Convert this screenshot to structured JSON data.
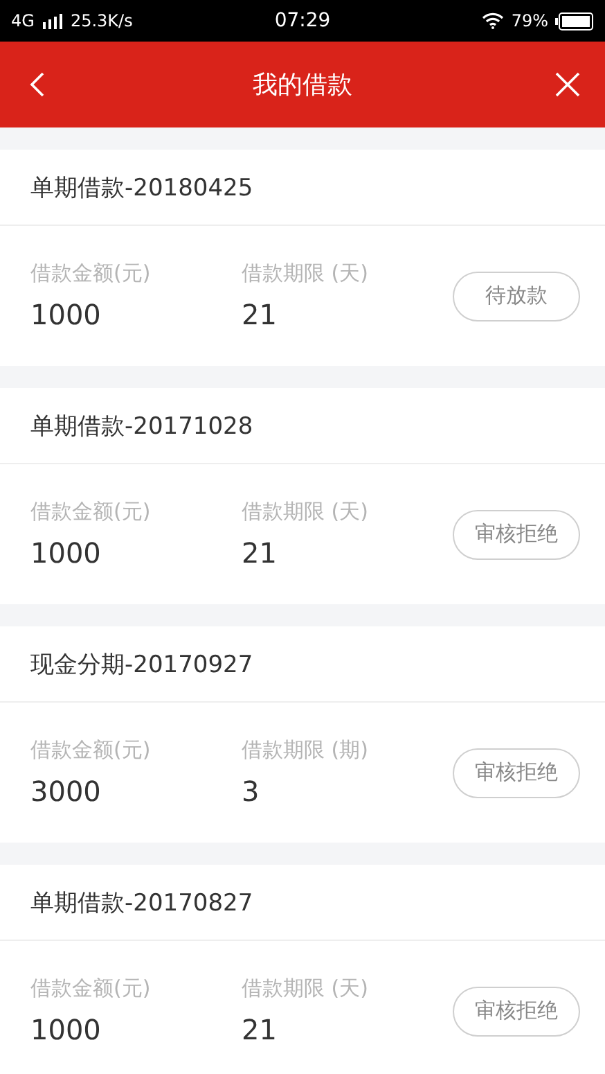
{
  "status_bar": {
    "network": "4G",
    "speed": "25.3K/s",
    "time": "07:29",
    "battery": "79%"
  },
  "header": {
    "title": "我的借款"
  },
  "loans": [
    {
      "title": "单期借款-20180425",
      "amount_label": "借款金额(元)",
      "amount": "1000",
      "term_label": "借款期限 (天)",
      "term": "21",
      "status": "待放款"
    },
    {
      "title": "单期借款-20171028",
      "amount_label": "借款金额(元)",
      "amount": "1000",
      "term_label": "借款期限 (天)",
      "term": "21",
      "status": "审核拒绝"
    },
    {
      "title": "现金分期-20170927",
      "amount_label": "借款金额(元)",
      "amount": "3000",
      "term_label": "借款期限 (期)",
      "term": "3",
      "status": "审核拒绝"
    },
    {
      "title": "单期借款-20170827",
      "amount_label": "借款金额(元)",
      "amount": "1000",
      "term_label": "借款期限 (天)",
      "term": "21",
      "status": "审核拒绝"
    }
  ]
}
